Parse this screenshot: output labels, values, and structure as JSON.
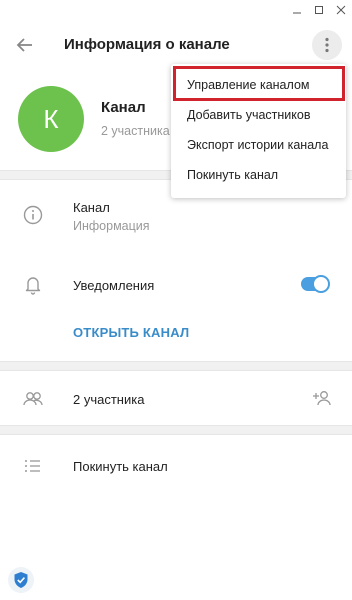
{
  "window": {
    "minimize_icon": "minimize-icon",
    "maximize_icon": "maximize-icon",
    "close_icon": "close-icon"
  },
  "header": {
    "title": "Информация о канале",
    "back_icon": "arrow-left-icon",
    "more_icon": "more-vertical-icon"
  },
  "profile": {
    "avatar_letter": "К",
    "avatar_color": "#6dc24d",
    "name": "Канал",
    "subtitle": "2 участника"
  },
  "info": {
    "icon": "info-icon",
    "title": "Канал",
    "subtitle": "Информация"
  },
  "notifications": {
    "icon": "bell-icon",
    "label": "Уведомления",
    "enabled": true
  },
  "open_channel_label": "ОТКРЫТЬ КАНАЛ",
  "members": {
    "icon": "members-icon",
    "label": "2 участника",
    "add_icon": "add-member-icon"
  },
  "leave": {
    "icon": "list-icon",
    "label": "Покинуть канал"
  },
  "menu": {
    "items": [
      {
        "label": "Управление каналом",
        "highlighted": true
      },
      {
        "label": "Добавить участников"
      },
      {
        "label": "Экспорт истории канала"
      },
      {
        "label": "Покинуть канал"
      }
    ],
    "highlight_color": "#d0232d"
  },
  "colors": {
    "accent": "#3a8cc9",
    "toggle": "#4a9fe0",
    "muted_text": "#999999"
  }
}
